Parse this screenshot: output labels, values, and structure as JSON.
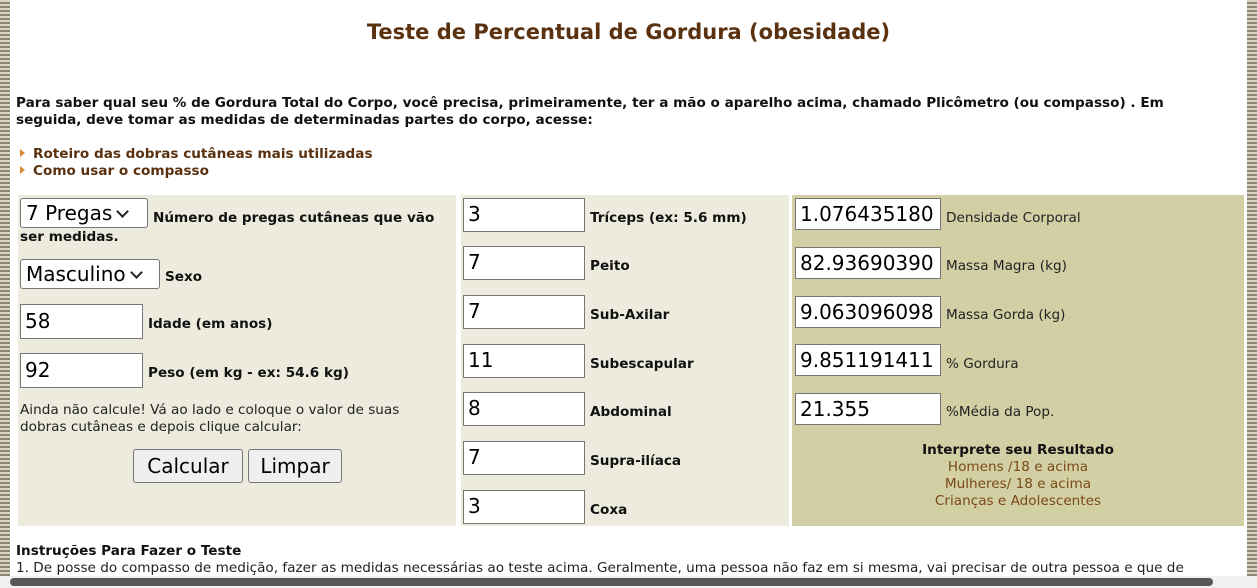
{
  "title": "Teste de Percentual de Gordura (obesidade)",
  "intro": " Para saber qual seu % de Gordura Total do Corpo, você precisa, primeiramente, ter a mão o aparelho acima, chamado Plicômetro (ou compasso) . Em seguida, deve tomar as medidas de determinadas partes do corpo, acesse:",
  "links": [
    "Roteiro das dobras cutâneas mais utilizadas",
    "Como usar o compasso"
  ],
  "left": {
    "folds_select": "7 Pregas",
    "folds_label": "Número de pregas cutâneas que vão ser medidas.",
    "sex_select": "Masculino",
    "sex_label": "Sexo",
    "age_value": "58",
    "age_label": "Idade (em anos)",
    "weight_value": "92",
    "weight_label": "Peso (em kg - ex: 54.6 kg)",
    "note": "Ainda não calcule! Vá ao lado e coloque o valor de suas dobras cutâneas e depois clique calcular:",
    "calc_button": "Calcular",
    "clear_button": "Limpar"
  },
  "folds": [
    {
      "value": "3",
      "label": "Tríceps (ex: 5.6 mm)"
    },
    {
      "value": "7",
      "label": "Peito"
    },
    {
      "value": "7",
      "label": "Sub-Axilar"
    },
    {
      "value": "11",
      "label": "Subescapular"
    },
    {
      "value": "8",
      "label": "Abdominal"
    },
    {
      "value": "7",
      "label": "Supra-ilíaca"
    },
    {
      "value": "3",
      "label": "Coxa"
    }
  ],
  "results": [
    {
      "value": "1.076435180",
      "label": "Densidade Corporal"
    },
    {
      "value": "82.93690390",
      "label": "Massa Magra (kg)"
    },
    {
      "value": "9.063096098",
      "label": "Massa Gorda (kg)"
    },
    {
      "value": "9.851191411",
      "label": "% Gordura"
    },
    {
      "value": "21.355",
      "label": "%Média da Pop."
    }
  ],
  "interpret": {
    "title": "Interprete seu Resultado",
    "links": [
      "Homens /18 e acima",
      "Mulheres/ 18 e acima",
      "Crianças e Adolescentes"
    ]
  },
  "instructions": {
    "title": "Instruções Para Fazer o Teste",
    "text": "1. De posse do compasso de medição, fazer as medidas necessárias ao teste acima. Geralmente, uma pessoa não faz em si mesma, vai precisar de outra pessoa e que de"
  }
}
